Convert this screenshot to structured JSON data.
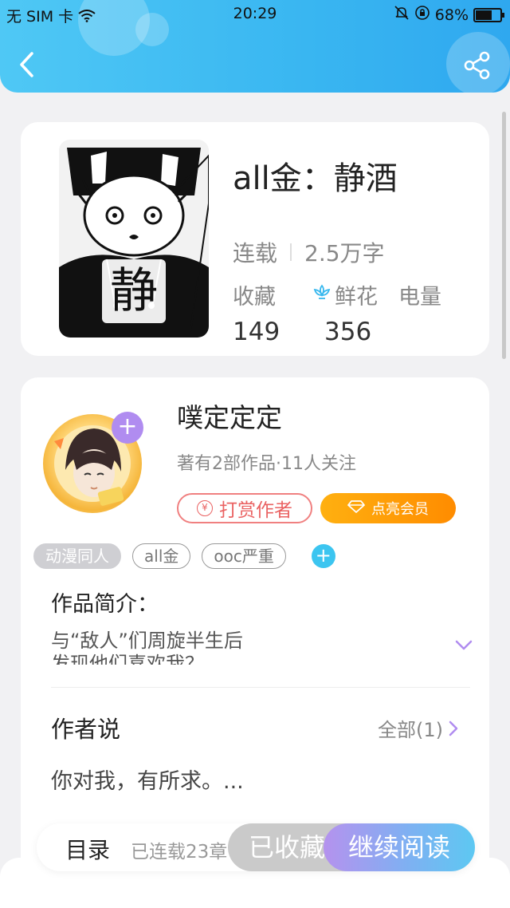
{
  "status_bar": {
    "carrier": "无 SIM 卡",
    "time": "20:29",
    "battery": "68%",
    "battery_level": 0.68
  },
  "header": {
    "back_icon": "chevron-left-icon",
    "share_icon": "share-icon"
  },
  "book": {
    "title": "all金：静酒",
    "status": "连载",
    "word_count": "2.5万字",
    "stats_labels": {
      "favorites": "收藏",
      "flowers": "鲜花",
      "power": "电量"
    },
    "favorites": "149",
    "flowers": "356",
    "cover_text": "静"
  },
  "author": {
    "name": "噗定定定",
    "meta": "著有2部作品·11人关注",
    "tip_label": "打赏作者",
    "tip_icon_text": "¥",
    "vip_label": "点亮会员",
    "follow_plus": "+"
  },
  "tags": [
    "动漫同人",
    "all金",
    "ooc严重"
  ],
  "tag_add": "+",
  "intro": {
    "label": "作品简介：",
    "text": "与“敌人”们周旋半生后\n发现他们喜欢我？"
  },
  "author_says": {
    "label": "作者说",
    "all_label": "全部(1)",
    "text": "你对我，有所求。..."
  },
  "bottom": {
    "toc_label": "目录",
    "toc_count": "已连载23章",
    "collected_label": "已收藏",
    "read_label": "继续阅读"
  },
  "colors": {
    "header_blue": "#39b6f1",
    "accent_purple": "#b08cf0",
    "tip_red": "#ea6262",
    "vip_orange": "#ff8c00",
    "tag_add_blue": "#3cc5f0"
  }
}
